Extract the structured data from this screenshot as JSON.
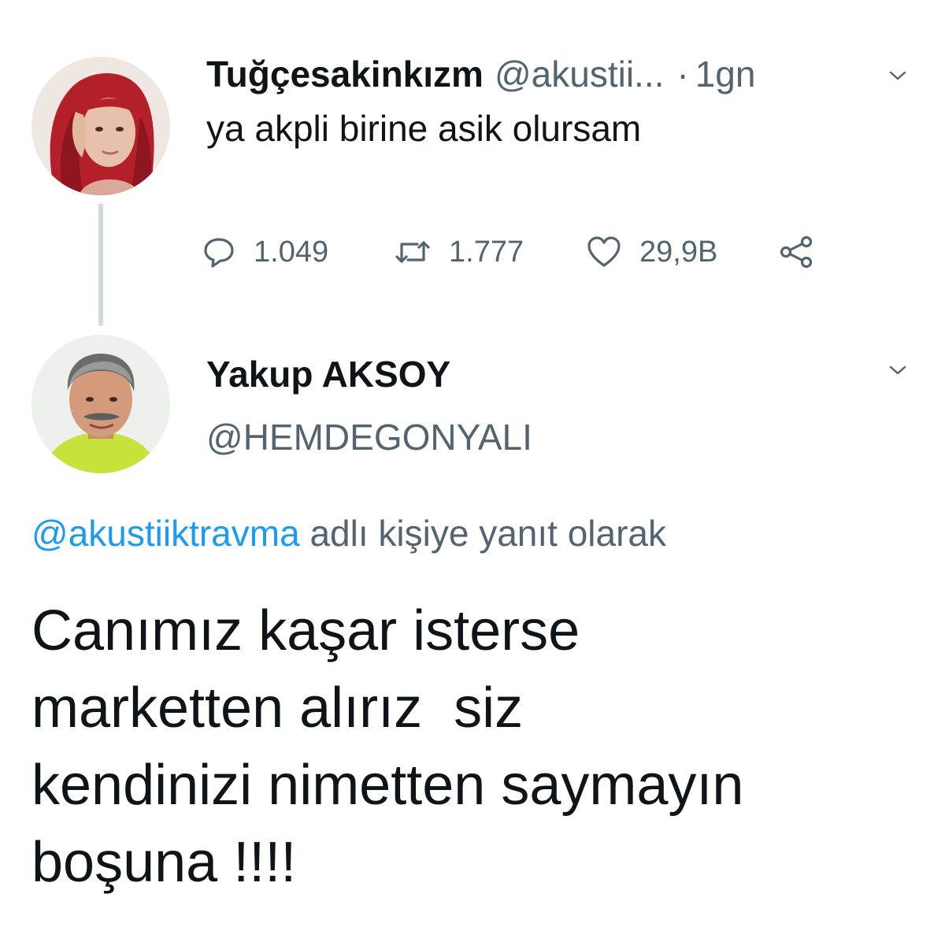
{
  "parent_tweet": {
    "display_name": "Tuğçesakinkızm",
    "handle": "@akustii...",
    "separator": "·",
    "time": "1gn",
    "text": "ya akpli birine asik olursam",
    "avatar_icon": "user-avatar-red-hair",
    "actions": {
      "reply_count": "1.049",
      "retweet_count": "1.777",
      "like_count": "29,9B",
      "reply_icon": "comment-bubble-icon",
      "retweet_icon": "retweet-icon",
      "like_icon": "heart-icon",
      "share_icon": "share-icon"
    }
  },
  "reply_tweet": {
    "display_name": "Yakup AKSOY",
    "handle": "@HEMDEGONYALI",
    "avatar_icon": "user-avatar-yellow-shirt",
    "reply_context": {
      "mention": "@akustiiktravma",
      "suffix": " adlı kişiye yanıt olarak"
    },
    "text_lines": [
      "Canımız kaşar isterse",
      "marketten alırız  siz",
      "kendinizi nimetten saymayın",
      "boşuna !!!!"
    ]
  },
  "colors": {
    "text_primary": "#0f1419",
    "text_secondary": "#536471",
    "link": "#1d9bf0",
    "thread_line": "#cfd9de"
  }
}
